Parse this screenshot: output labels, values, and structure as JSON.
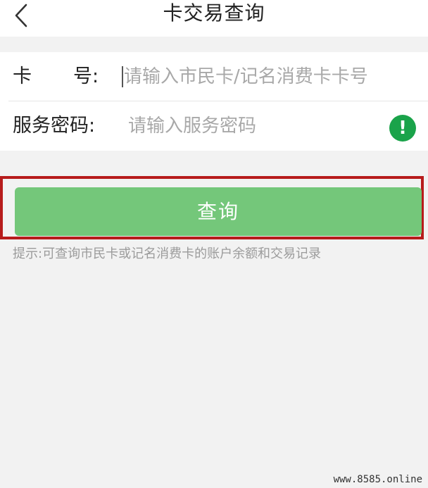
{
  "header": {
    "title": "卡交易查询"
  },
  "form": {
    "card_label_char1": "卡",
    "card_label_char2": "号:",
    "card_placeholder": "请输入市民卡/记名消费卡卡号",
    "password_label": "服务密码:",
    "password_placeholder": "请输入服务密码"
  },
  "icons": {
    "back": "chevron-left-icon",
    "info": "exclamation-icon",
    "info_color": "#1aa34a"
  },
  "actions": {
    "query_label": "查询",
    "button_color": "#74c77a",
    "highlight_color": "#b71c1c"
  },
  "hint": {
    "text": "提示:可查询市民卡或记名消费卡的账户余额和交易记录"
  },
  "watermark": {
    "text": "www.8585.online"
  }
}
